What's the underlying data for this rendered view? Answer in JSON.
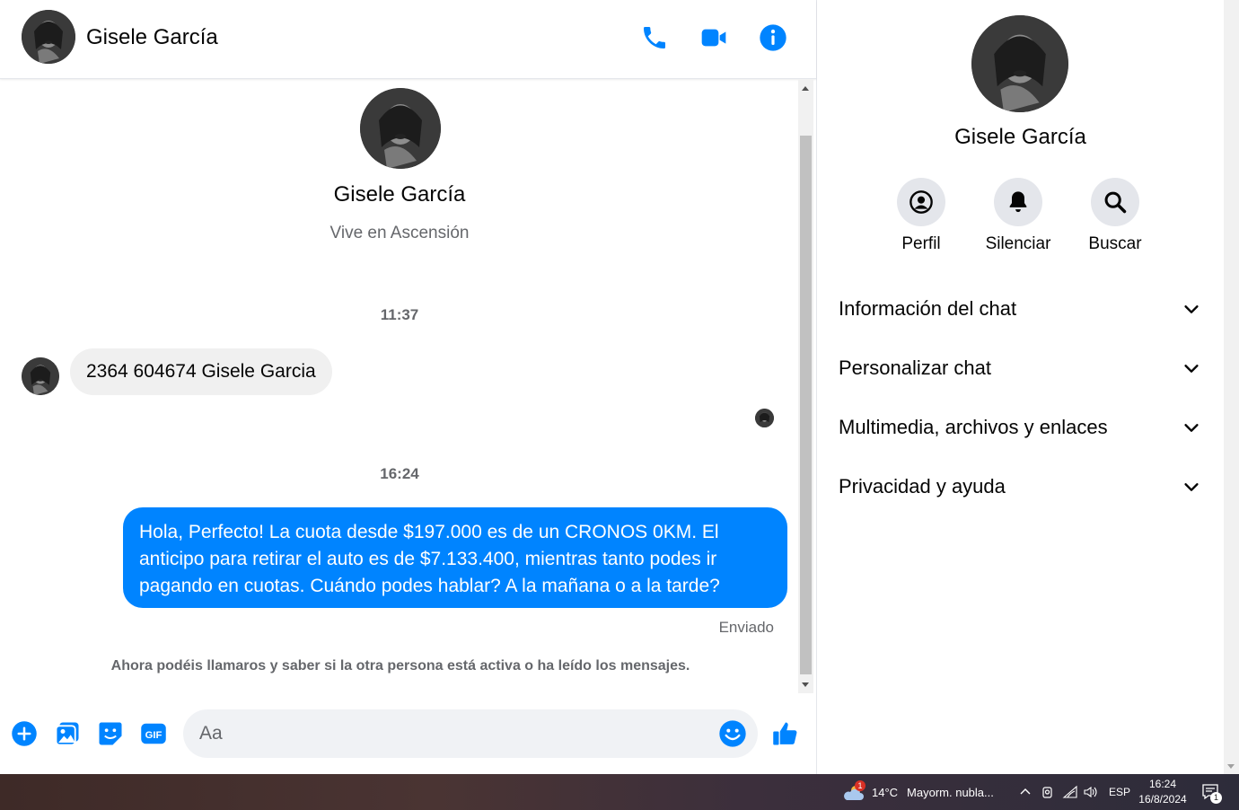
{
  "contact": {
    "name": "Gisele García",
    "location": "Vive en Ascensión"
  },
  "messages": {
    "time1": "11:37",
    "incoming_text": "2364 604674 Gisele Garcia",
    "time2": "16:24",
    "outgoing_text": "Hola, Perfecto! La cuota desde $197.000 es de un CRONOS 0KM. El anticipo para retirar el auto es de $7.133.400, mientras tanto podes ir pagando en cuotas. Cuándo podes hablar? A la mañana o a la tarde?",
    "sent_status": "Enviado",
    "notice": "Ahora podéis llamaros y saber si la otra persona está activa o ha leído los mensajes."
  },
  "composer": {
    "placeholder": "Aa"
  },
  "panel": {
    "actions": [
      {
        "label": "Perfil",
        "icon": "profile-icon"
      },
      {
        "label": "Silenciar",
        "icon": "bell-icon"
      },
      {
        "label": "Buscar",
        "icon": "search-icon"
      }
    ],
    "sections": [
      {
        "label": "Información del chat"
      },
      {
        "label": "Personalizar chat"
      },
      {
        "label": "Multimedia, archivos y enlaces"
      },
      {
        "label": "Privacidad y ayuda"
      }
    ]
  },
  "taskbar": {
    "weather_badge": "1",
    "temperature": "14°C",
    "weather_text": "Mayorm. nubla...",
    "language": "ESP",
    "time": "16:24",
    "date": "16/8/2024",
    "notification_count": "1"
  },
  "colors": {
    "accent": "#0084ff",
    "bubble_in": "#f0f0f0",
    "secondary_text": "#65676b"
  }
}
